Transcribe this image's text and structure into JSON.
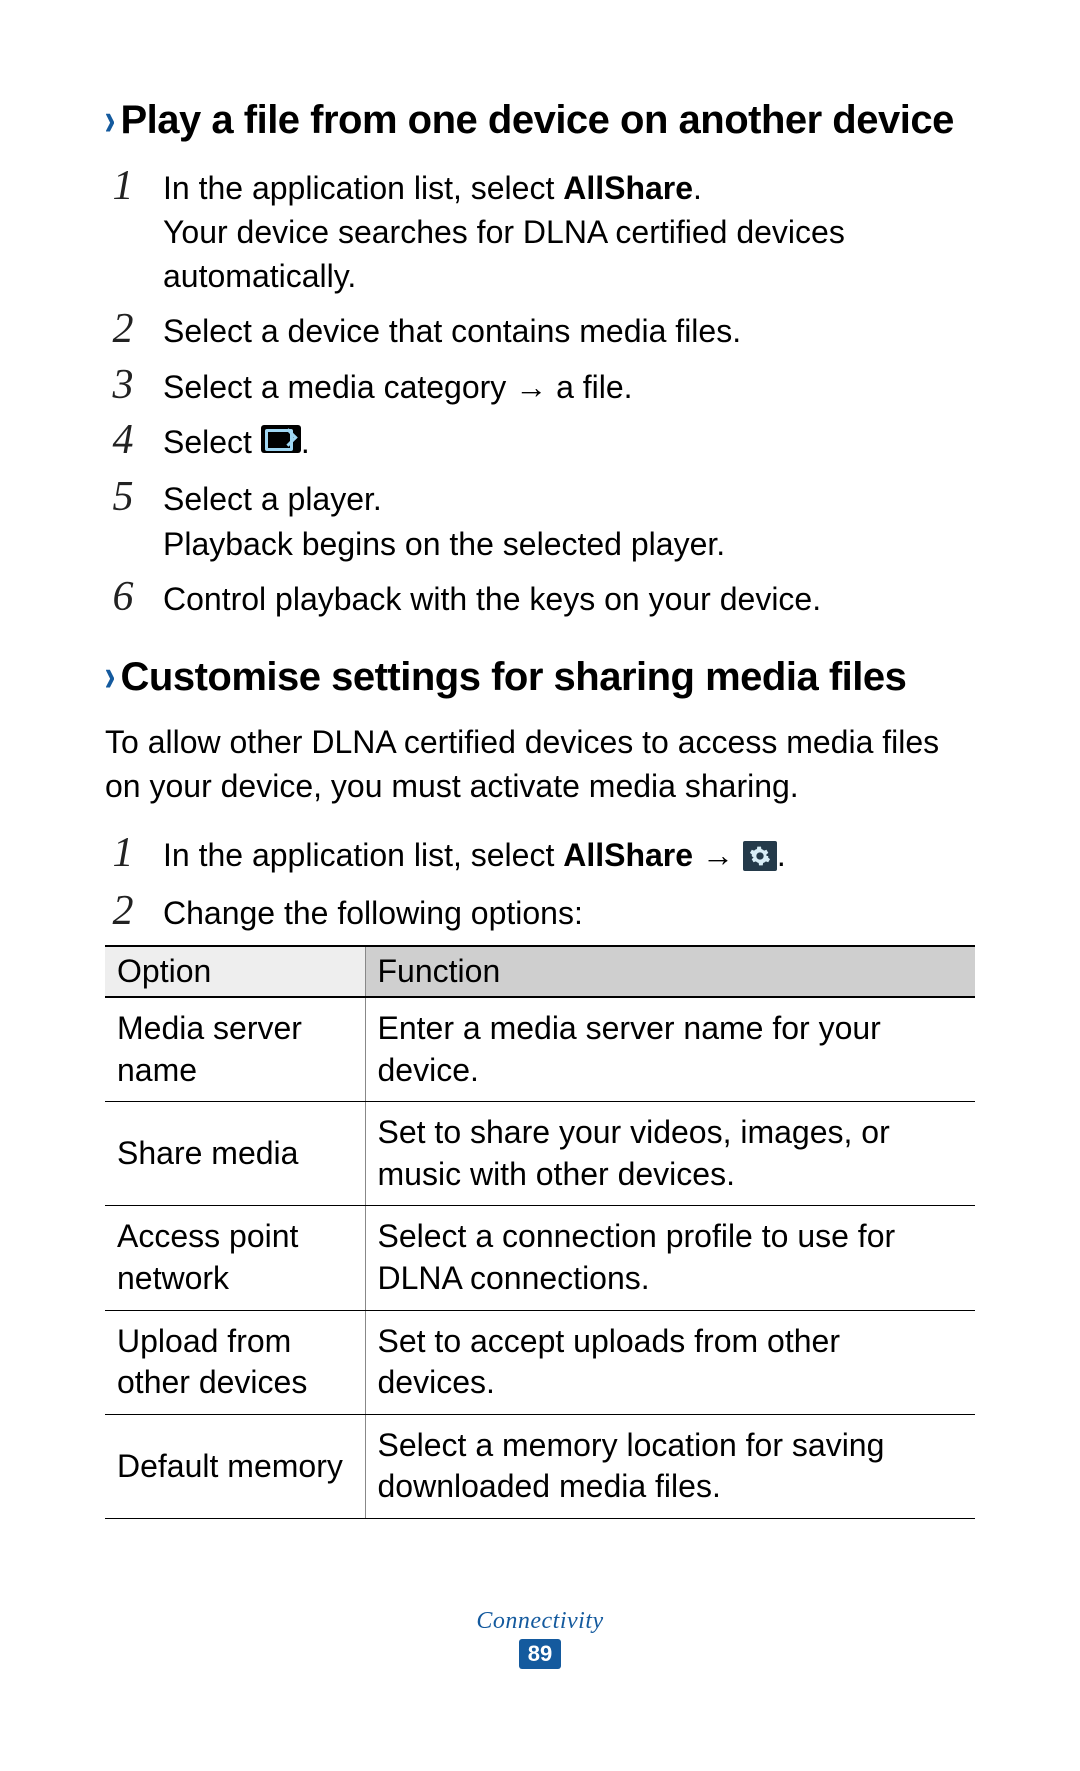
{
  "section1": {
    "heading": "Play a file from one device on another device",
    "steps": [
      {
        "num": "1",
        "line1_pre": "In the application list, select ",
        "line1_bold": "AllShare",
        "line1_post": ".",
        "line2": "Your device searches for DLNA certified devices automatically."
      },
      {
        "num": "2",
        "line1": "Select a device that contains media files."
      },
      {
        "num": "3",
        "line1": "Select a media category → a file."
      },
      {
        "num": "4",
        "line1_pre": "Select ",
        "icon": "screen",
        "line1_post": "."
      },
      {
        "num": "5",
        "line1": "Select a player.",
        "line2": "Playback begins on the selected player."
      },
      {
        "num": "6",
        "line1": "Control playback with the keys on your device."
      }
    ]
  },
  "section2": {
    "heading": "Customise settings for sharing media files",
    "intro": "To allow other DLNA certified devices to access media files on your device, you must activate media sharing.",
    "steps": [
      {
        "num": "1",
        "line1_pre": "In the application list, select ",
        "line1_bold": "AllShare",
        "arrow": " → ",
        "icon": "gear",
        "line1_post": "."
      },
      {
        "num": "2",
        "line1": "Change the following options:"
      }
    ],
    "table": {
      "headers": {
        "option": "Option",
        "function": "Function"
      },
      "rows": [
        {
          "option": "Media server name",
          "function": "Enter a media server name for your device."
        },
        {
          "option": "Share media",
          "function": "Set to share your videos, images, or music with other devices."
        },
        {
          "option": "Access point network",
          "function": "Select a connection profile to use for DLNA connections."
        },
        {
          "option": "Upload from other devices",
          "function": "Set to accept uploads from other devices."
        },
        {
          "option": "Default memory",
          "function": "Select a memory location for saving downloaded media files."
        }
      ]
    }
  },
  "footer": {
    "section": "Connectivity",
    "page": "89"
  }
}
